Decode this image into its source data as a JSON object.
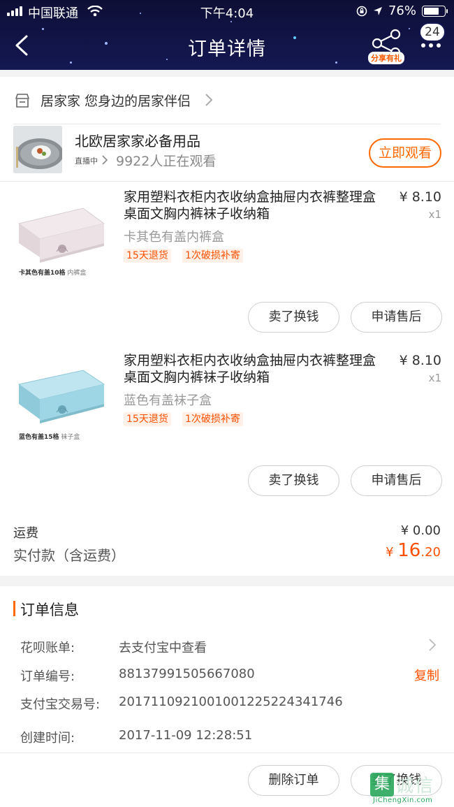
{
  "status_bar": {
    "carrier": "中国联通",
    "time": "下午4:04",
    "battery": "76%",
    "battery_level": 0.76
  },
  "header": {
    "title": "订单详情",
    "share_label": "分享有礼",
    "badge_count": "24"
  },
  "shop": {
    "name": "居家家 您身边的居家伴侣"
  },
  "live": {
    "title": "北欧居家家必备用品",
    "status_tag": "直播中",
    "viewers": "9922人正在观看",
    "watch_button": "立即观看"
  },
  "products": [
    {
      "title": "家用塑料衣柜内衣收纳盒抽屉内衣裤整理盒桌面文胸内裤袜子收纳箱",
      "price": "¥ 8.10",
      "qty": "x1",
      "spec": "卡其色有盖内裤盒",
      "tags": [
        "15天退货",
        "1次破损补寄"
      ],
      "image_caption_bold": "卡其色有盖10格",
      "image_caption": "内裤盒",
      "color": "#ece2e6",
      "btn_sell": "卖了换钱",
      "btn_after_sale": "申请售后"
    },
    {
      "title": "家用塑料衣柜内衣收纳盒抽屉内衣裤整理盒桌面文胸内裤袜子收纳箱",
      "price": "¥ 8.10",
      "qty": "x1",
      "spec": "蓝色有盖袜子盒",
      "tags": [
        "15天退货",
        "1次破损补寄"
      ],
      "image_caption_bold": "蓝色有盖15格",
      "image_caption": "袜子盒",
      "color": "#9fd6e6",
      "btn_sell": "卖了换钱",
      "btn_after_sale": "申请售后"
    }
  ],
  "summary": {
    "shipping_label": "运费",
    "shipping_value": "¥ 0.00",
    "paid_label": "实付款（含运费）",
    "paid_currency": "¥ ",
    "paid_int": "16",
    "paid_dec": ".20"
  },
  "order_info": {
    "section_title": "订单信息",
    "rows": [
      {
        "label": "花呗账单:",
        "value": "去支付宝中查看"
      },
      {
        "label": "订单编号:",
        "value": "88137991505667080"
      },
      {
        "label": "支付宝交易号:",
        "value": "2017110921001001225224341746"
      },
      {
        "label": "创建时间:",
        "value": "2017-11-09 12:28:51"
      }
    ],
    "copy_label": "复制"
  },
  "bottom_bar": {
    "delete_button": "删除订单",
    "sell_button": "卖了换钱"
  },
  "watermark": {
    "box_char": "集",
    "text": "诚信",
    "url": "JiChengXin.com"
  },
  "colors": {
    "accent": "#ff6a00",
    "price_red": "#ff5000",
    "header_bg": "#0d0f36"
  }
}
